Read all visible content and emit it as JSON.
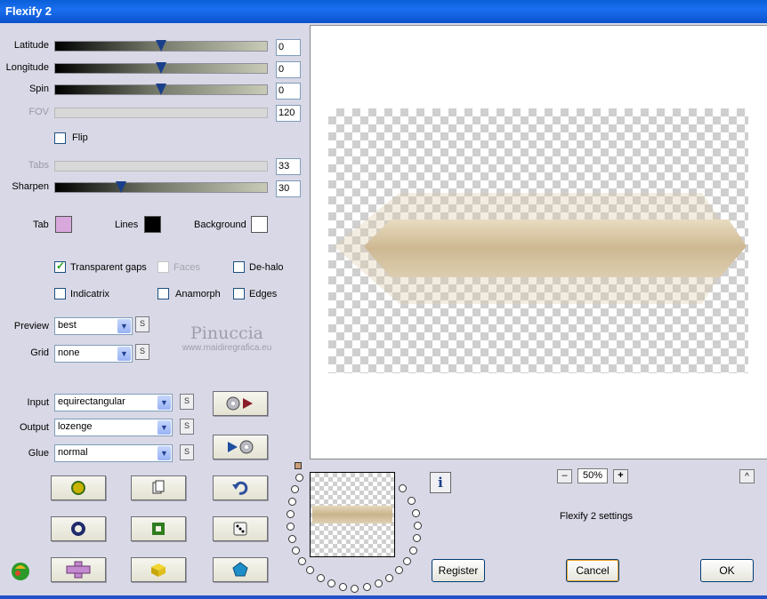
{
  "window": {
    "title": "Flexify 2"
  },
  "sliders": [
    {
      "label": "Latitude",
      "value": "0",
      "position": 0.5,
      "disabled": false
    },
    {
      "label": "Longitude",
      "value": "0",
      "position": 0.5,
      "disabled": false
    },
    {
      "label": "Spin",
      "value": "0",
      "position": 0.5,
      "disabled": false
    },
    {
      "label": "FOV",
      "value": "120",
      "position": 0.0,
      "disabled": true
    },
    {
      "label": "Tabs",
      "value": "33",
      "position": 0.0,
      "disabled": true
    },
    {
      "label": "Sharpen",
      "value": "30",
      "position": 0.3,
      "disabled": false
    }
  ],
  "flip": {
    "label": "Flip",
    "checked": false
  },
  "colors": {
    "tab": {
      "label": "Tab",
      "color": "#d8a7dc"
    },
    "lines": {
      "label": "Lines",
      "color": "#000000"
    },
    "background": {
      "label": "Background",
      "color": "#ffffff"
    }
  },
  "options": {
    "transparent_gaps": {
      "label": "Transparent gaps",
      "checked": true
    },
    "faces": {
      "label": "Faces",
      "checked": false,
      "disabled": true
    },
    "de_halo": {
      "label": "De-halo",
      "checked": false
    },
    "indicatrix": {
      "label": "Indicatrix",
      "checked": false
    },
    "anamorph": {
      "label": "Anamorph",
      "checked": false
    },
    "edges": {
      "label": "Edges",
      "checked": false
    }
  },
  "preview": {
    "label": "Preview",
    "value": "best"
  },
  "grid": {
    "label": "Grid",
    "value": "none"
  },
  "watermark": {
    "name": "Pinuccia",
    "site": "www.maidiregrafica.eu"
  },
  "input": {
    "label": "Input",
    "value": "equirectangular"
  },
  "output": {
    "label": "Output",
    "value": "lozenge"
  },
  "glue": {
    "label": "Glue",
    "value": "normal"
  },
  "s_button": "S",
  "zoom": {
    "minus": "–",
    "value": "50%",
    "plus": "+"
  },
  "collapse": "^",
  "settings_label": "Flexify 2 settings",
  "info": "i",
  "buttons": {
    "register": "Register",
    "cancel": "Cancel",
    "ok": "OK"
  }
}
